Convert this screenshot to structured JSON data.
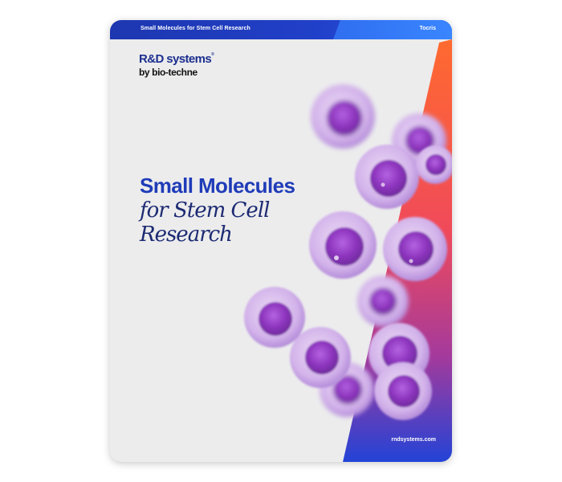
{
  "header": {
    "title": "Small Molecules for Stem Cell Research",
    "brand": "Tocris"
  },
  "logo": {
    "main": "R&D systems",
    "tm": "®",
    "sub": "by bio-techne"
  },
  "cover": {
    "title_line1": "Small Molecules",
    "title_line2": "for Stem Cell",
    "title_line3": "Research"
  },
  "footer": {
    "url": "rndsystems.com"
  },
  "colors": {
    "primary_blue": "#1f3cb8",
    "navy": "#1c2a72",
    "accent_orange": "#ff6a2f",
    "cell_purple": "#9a46c8",
    "background": "#ececed"
  }
}
